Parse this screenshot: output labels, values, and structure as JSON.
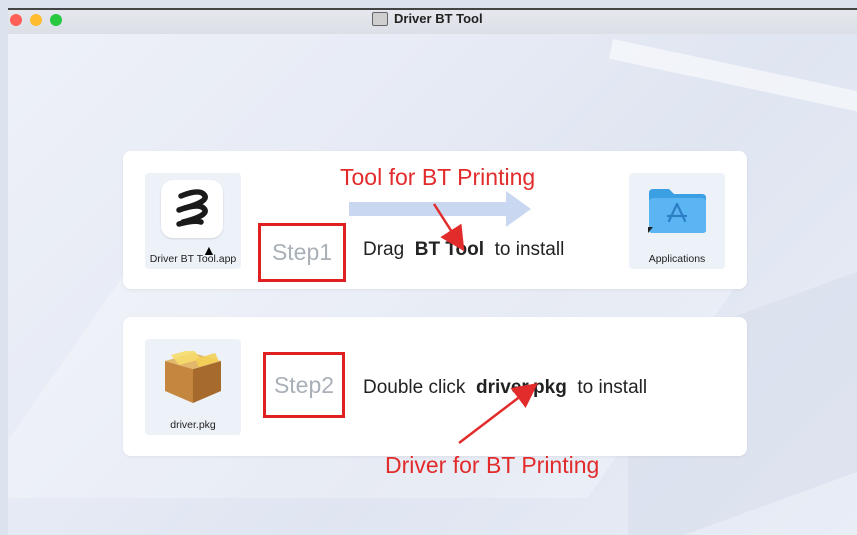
{
  "window": {
    "title": "Driver BT Tool"
  },
  "step1": {
    "app_label": "Driver BT Tool.app",
    "step_label": "Step1",
    "instruction_prefix": "Drag",
    "instruction_bold": "BT Tool",
    "instruction_suffix": "to install",
    "target_label": "Applications",
    "annotation": "Tool for BT Printing"
  },
  "step2": {
    "pkg_label": "driver.pkg",
    "step_label": "Step2",
    "instruction_prefix": "Double click",
    "instruction_bold": "driver.pkg",
    "instruction_suffix": "to install",
    "annotation": "Driver for BT Printing"
  },
  "colors": {
    "annotation_red": "#e22b2b",
    "folder_blue": "#3b9fe3"
  },
  "icons": [
    "app-logo-icon",
    "applications-folder-icon",
    "package-icon",
    "drag-arrow-icon",
    "cursor-icon"
  ]
}
